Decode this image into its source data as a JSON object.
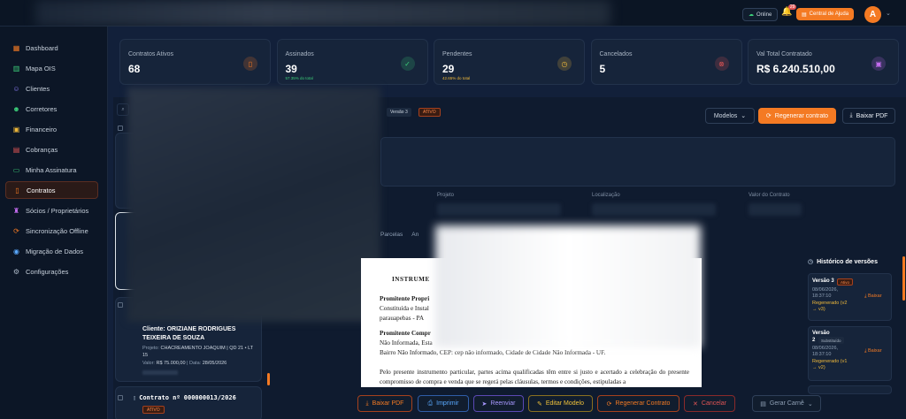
{
  "topbar": {
    "online": "Online",
    "notification_count": "29",
    "help": "Central de Ajuda",
    "avatar_initial": "A"
  },
  "sidebar": {
    "items": [
      {
        "label": "Dashboard",
        "icon": "dashboard-icon",
        "color": "#f47a23"
      },
      {
        "label": "Mapa OIS",
        "icon": "map-icon",
        "color": "#3ccf7a"
      },
      {
        "label": "Clientes",
        "icon": "users-icon",
        "color": "#8b7cf6"
      },
      {
        "label": "Corretores",
        "icon": "user-group-icon",
        "color": "#3ccf7a"
      },
      {
        "label": "Financeiro",
        "icon": "wallet-icon",
        "color": "#f0b93a"
      },
      {
        "label": "Cobranças",
        "icon": "billing-icon",
        "color": "#e25555"
      },
      {
        "label": "Minha Assinatura",
        "icon": "card-icon",
        "color": "#3ccf7a"
      },
      {
        "label": "Contratos",
        "icon": "document-icon",
        "color": "#f47a23"
      },
      {
        "label": "Sócios / Proprietários",
        "icon": "partners-icon",
        "color": "#c56cf0"
      },
      {
        "label": "Sincronização Offline",
        "icon": "sync-icon",
        "color": "#f47a23"
      },
      {
        "label": "Migração de Dados",
        "icon": "database-icon",
        "color": "#5aa9ff"
      },
      {
        "label": "Configurações",
        "icon": "gear-icon",
        "color": "#aab6c5"
      }
    ]
  },
  "stats": [
    {
      "label": "Contratos Ativos",
      "value": "68",
      "sub": "",
      "color": "#f47a23",
      "icon": "document-icon"
    },
    {
      "label": "Assinados",
      "value": "39",
      "sub": "57.35% do total",
      "color": "#3ccf7a",
      "icon": "check-icon"
    },
    {
      "label": "Pendentes",
      "value": "29",
      "sub": "42.65% do total",
      "color": "#f0b93a",
      "icon": "clock-icon"
    },
    {
      "label": "Cancelados",
      "value": "5",
      "sub": "",
      "color": "#e25555",
      "icon": "cancel-icon"
    },
    {
      "label": "Val Total Contratado",
      "value": "R$ 6.240.510,00",
      "sub": "",
      "color": "#c56cf0",
      "icon": "wallet-icon"
    }
  ],
  "detail": {
    "version_tag": "Versão 3",
    "status_tag": "ATIVO",
    "models": "Modelos",
    "regen": "Regenerar contrato",
    "download": "Baixar PDF",
    "labels": [
      "Projeto",
      "Localização",
      "Valor do Contrato"
    ],
    "tabs": [
      "Parcelas",
      "An"
    ]
  },
  "list": {
    "client": "Cliente: ORIZIANE RODRIGUES TEIXEIRA DE SOUZA",
    "project_label": "Projeto:",
    "project": "CHACREAMENTO JOAQUIM | QD 21 • LT 15",
    "value_label": "Valor:",
    "value": "R$ 75.000,00",
    "date_label": "Data:",
    "date": "28/05/2026",
    "contract_title": "Contrato nº 000000013/2026",
    "contract_status": "ATIVO"
  },
  "document": {
    "title": "INSTRUME",
    "p1_bold": "Promitente Propri",
    "p1_l2": "Constituída e Instal",
    "p1_l3": "parauapebas - PA",
    "p2_bold": "Promitente Compr",
    "p2_l2": "Não Informada, Esta",
    "p2_l3": "Bairro Não Informado, CEP: cep não informado, Cidade de Cidade Não Informada - UF.",
    "p3": "Pelo presente instrumento particular, partes acima qualificadas têm entre si justo e acertado a celebração do presente compromisso de compra e venda que se regerá pelas cláusulas, termos e condições, estipuladas a"
  },
  "history": {
    "title": "Histórico de versões",
    "versions": [
      {
        "version": "Versão 3",
        "badge": "Ativo",
        "date": "08/06/2026, 18:37:10",
        "regen": "Regenerado (v2 → v3)",
        "download": "Baixar"
      },
      {
        "version": "Versão 2",
        "badge": "Substituído",
        "date": "08/06/2026, 18:37:10",
        "regen": "Regenerado (v1 → v2)",
        "download": "Baixar"
      }
    ]
  },
  "bottombar": {
    "pdf": "Baixar PDF",
    "print": "Imprimir",
    "resend": "Reenviar",
    "edit": "Editar Modelo",
    "regen": "Regenerar Contrato",
    "cancel": "Cancelar",
    "carne": "Gerar Carnê"
  }
}
